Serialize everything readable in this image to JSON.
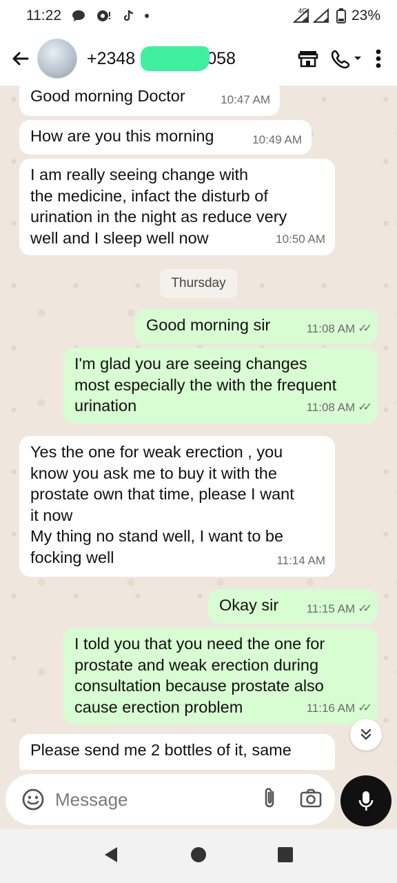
{
  "status_bar": {
    "time": "11:22",
    "network": "4G",
    "battery": "23%"
  },
  "header": {
    "contact_name": "+2348",
    "contact_name_suffix": "058"
  },
  "chat": {
    "messages": [
      {
        "direction": "in",
        "text": "Good morning Doctor",
        "time": "10:47 AM"
      },
      {
        "direction": "in",
        "text": "How are you this morning",
        "time": "10:49 AM"
      },
      {
        "direction": "in",
        "text": "I am really seeing change with\nthe medicine, infact the disturb of\nurination in the night as reduce very\nwell and I sleep well now",
        "time": "10:50 AM"
      },
      {
        "direction": "out",
        "text": "Good morning sir",
        "time": "11:08 AM"
      },
      {
        "direction": "out",
        "text": "I'm glad you are seeing changes\nmost especially the with the frequent\nurination",
        "time": "11:08 AM"
      },
      {
        "direction": "in",
        "text": "Yes the one for weak erection , you\nknow you ask me to buy it with the\nprostate own that time, please I want\nit now\nMy thing no stand well, I want to be\nfocking well",
        "time": "11:14 AM"
      },
      {
        "direction": "out",
        "text": "Okay sir",
        "time": "11:15 AM"
      },
      {
        "direction": "out",
        "text": "I told you that you need the one for\nprostate and weak erection during\nconsultation because prostate also\ncause erection problem",
        "time": "11:16 AM"
      },
      {
        "direction": "in",
        "text": "Please send me 2 bottles of it, same",
        "time": ""
      }
    ],
    "day_separator": "Thursday"
  },
  "input": {
    "placeholder": "Message"
  },
  "colors": {
    "incoming_bubble": "#ffffff",
    "outgoing_bubble": "#d8fdd2",
    "chat_background": "#efe7de",
    "redaction": "#3ef0a0"
  },
  "icons": {
    "back": "arrow-left-icon",
    "shop": "store-icon",
    "call": "phone-icon",
    "menu": "more-vertical-icon",
    "emoji": "emoji-icon",
    "attach": "paperclip-icon",
    "camera": "camera-icon",
    "mic": "mic-icon",
    "scroll_down": "double-chevron-down-icon",
    "nav_back": "triangle-back-icon",
    "nav_home": "circle-home-icon",
    "nav_recents": "square-recents-icon"
  }
}
